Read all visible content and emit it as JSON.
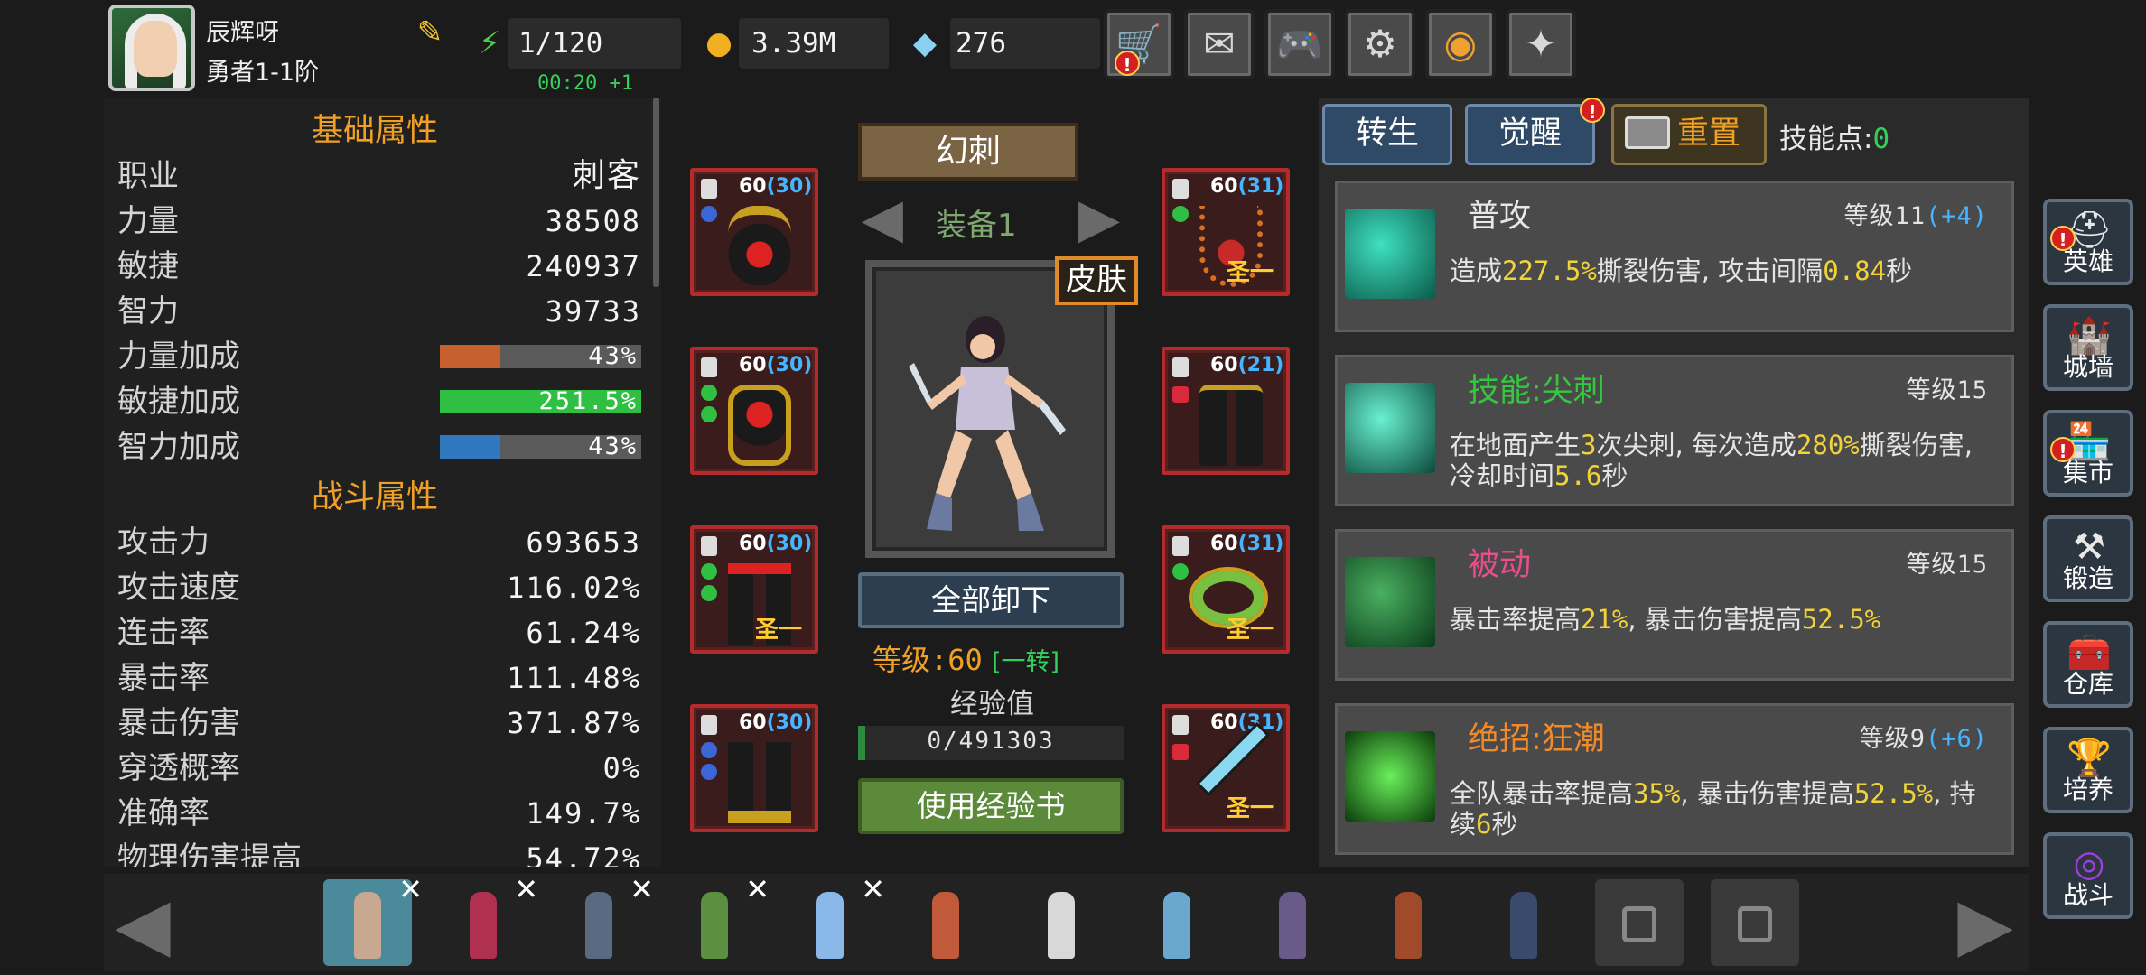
{
  "player": {
    "name": "辰辉呀",
    "rank": "勇者1-1阶"
  },
  "resources": {
    "stamina": "1/120",
    "regen": "00:20 +1",
    "gold": "3.39M",
    "gems": "276"
  },
  "top_buttons": [
    "shop-icon",
    "mail-icon",
    "gamepad-icon",
    "settings-icon",
    "color-wheel-icon",
    "fireworks-icon"
  ],
  "stats": {
    "basic_title": "基础属性",
    "basic": [
      {
        "label": "职业",
        "value": "刺客"
      },
      {
        "label": "力量",
        "value": "38508"
      },
      {
        "label": "敏捷",
        "value": "240937"
      },
      {
        "label": "智力",
        "value": "39733"
      }
    ],
    "bonuses": [
      {
        "label": "力量加成",
        "value": "43%",
        "fill": 0.3,
        "color": "#c8602e"
      },
      {
        "label": "敏捷加成",
        "value": "251.5%",
        "fill": 1.0,
        "color": "#2fbf43"
      },
      {
        "label": "智力加成",
        "value": "43%",
        "fill": 0.3,
        "color": "#2f78c0"
      }
    ],
    "combat_title": "战斗属性",
    "combat": [
      {
        "label": "攻击力",
        "value": "693653"
      },
      {
        "label": "攻击速度",
        "value": "116.02%"
      },
      {
        "label": "连击率",
        "value": "61.24%"
      },
      {
        "label": "暴击率",
        "value": "111.48%"
      },
      {
        "label": "暴击伤害",
        "value": "371.87%"
      },
      {
        "label": "穿透概率",
        "value": "0%"
      },
      {
        "label": "准确率",
        "value": "149.7%"
      },
      {
        "label": "物理伤害提高",
        "value": "54.72%"
      }
    ]
  },
  "hero": {
    "class_name": "幻刺",
    "loadout": "装备1",
    "skin_label": "皮肤",
    "unequip_label": "全部卸下",
    "level_text": "等级:60",
    "transfer_text": "[一转]",
    "exp_label": "经验值",
    "exp_value": "0/491303",
    "exp_book_label": "使用经验书"
  },
  "equipment": {
    "left": [
      {
        "level": "60",
        "plus": "(30)",
        "tag": ""
      },
      {
        "level": "60",
        "plus": "(30)",
        "tag": ""
      },
      {
        "level": "60",
        "plus": "(30)",
        "tag": "圣一"
      },
      {
        "level": "60",
        "plus": "(30)",
        "tag": ""
      }
    ],
    "right": [
      {
        "level": "60",
        "plus": "(31)",
        "tag": "圣一"
      },
      {
        "level": "60",
        "plus": "(21)",
        "tag": ""
      },
      {
        "level": "60",
        "plus": "(31)",
        "tag": "圣一"
      },
      {
        "level": "60",
        "plus": "(31)",
        "tag": "圣一"
      }
    ]
  },
  "skills_header": {
    "rebirth": "转生",
    "awaken": "觉醒",
    "reset": "重置",
    "points_label": "技能点:",
    "points_value": "0"
  },
  "skills": [
    {
      "name": "普攻",
      "name_color": "#e8e8e8",
      "level": "等级11",
      "level_bonus": "(+4)",
      "desc": [
        [
          "造成",
          ""
        ],
        [
          "227.5%",
          "y"
        ],
        [
          "撕裂伤害, 攻击间隔",
          ""
        ],
        [
          "0.84",
          "y"
        ],
        [
          "秒",
          ""
        ]
      ]
    },
    {
      "name": "技能:尖刺",
      "name_color": "#35c83f",
      "level": "等级15",
      "level_bonus": "",
      "desc": [
        [
          "在地面产生",
          ""
        ],
        [
          "3",
          "y"
        ],
        [
          "次尖刺, 每次造成",
          ""
        ],
        [
          "280%",
          "y"
        ],
        [
          "撕裂伤害, 冷却时间",
          ""
        ],
        [
          "5.6",
          "y"
        ],
        [
          "秒",
          ""
        ]
      ]
    },
    {
      "name": "被动",
      "name_color": "#e84f8a",
      "level": "等级15",
      "level_bonus": "",
      "desc": [
        [
          "暴击率提高",
          ""
        ],
        [
          "21%",
          "y"
        ],
        [
          ", 暴击伤害提高",
          ""
        ],
        [
          "52.5%",
          "y"
        ]
      ]
    },
    {
      "name": "绝招:狂潮",
      "name_color": "#f08a2a",
      "level": "等级9",
      "level_bonus": "(+6)",
      "desc": [
        [
          "全队暴击率提高",
          ""
        ],
        [
          "35%",
          "y"
        ],
        [
          ", 暴击伤害提高",
          ""
        ],
        [
          "52.5%",
          "y"
        ],
        [
          ", 持续",
          ""
        ],
        [
          "6",
          "y"
        ],
        [
          "秒",
          ""
        ]
      ]
    }
  ],
  "nav": [
    {
      "label": "英雄",
      "icon": "helmet-icon",
      "alert": true
    },
    {
      "label": "城墙",
      "icon": "castle-wall-icon",
      "alert": false
    },
    {
      "label": "集市",
      "icon": "market-icon",
      "alert": true
    },
    {
      "label": "锻造",
      "icon": "anvil-icon",
      "alert": false
    },
    {
      "label": "仓库",
      "icon": "chest-icon",
      "alert": false
    },
    {
      "label": "培养",
      "icon": "chalice-icon",
      "alert": false
    },
    {
      "label": "战斗",
      "icon": "portal-icon",
      "alert": false
    }
  ],
  "roster": [
    {
      "color": "#c8a890",
      "selected": true,
      "has_x": true,
      "locked": false
    },
    {
      "color": "#b03050",
      "selected": false,
      "has_x": true,
      "locked": false
    },
    {
      "color": "#5a6a80",
      "selected": false,
      "has_x": true,
      "locked": false
    },
    {
      "color": "#5a9040",
      "selected": false,
      "has_x": true,
      "locked": false
    },
    {
      "color": "#8ab8e8",
      "selected": false,
      "has_x": true,
      "locked": false
    },
    {
      "color": "#c05a3a",
      "selected": false,
      "has_x": false,
      "locked": false
    },
    {
      "color": "#d8d8d8",
      "selected": false,
      "has_x": false,
      "locked": false
    },
    {
      "color": "#6aa8d0",
      "selected": false,
      "has_x": false,
      "locked": false
    },
    {
      "color": "#6a5a8a",
      "selected": false,
      "has_x": false,
      "locked": false
    },
    {
      "color": "#a04a2a",
      "selected": false,
      "has_x": false,
      "locked": false
    },
    {
      "color": "#3a4a6a",
      "selected": false,
      "has_x": false,
      "locked": false
    },
    {
      "color": "#3a3a3a",
      "selected": false,
      "has_x": false,
      "locked": true
    },
    {
      "color": "#3a3a3a",
      "selected": false,
      "has_x": false,
      "locked": true
    }
  ]
}
